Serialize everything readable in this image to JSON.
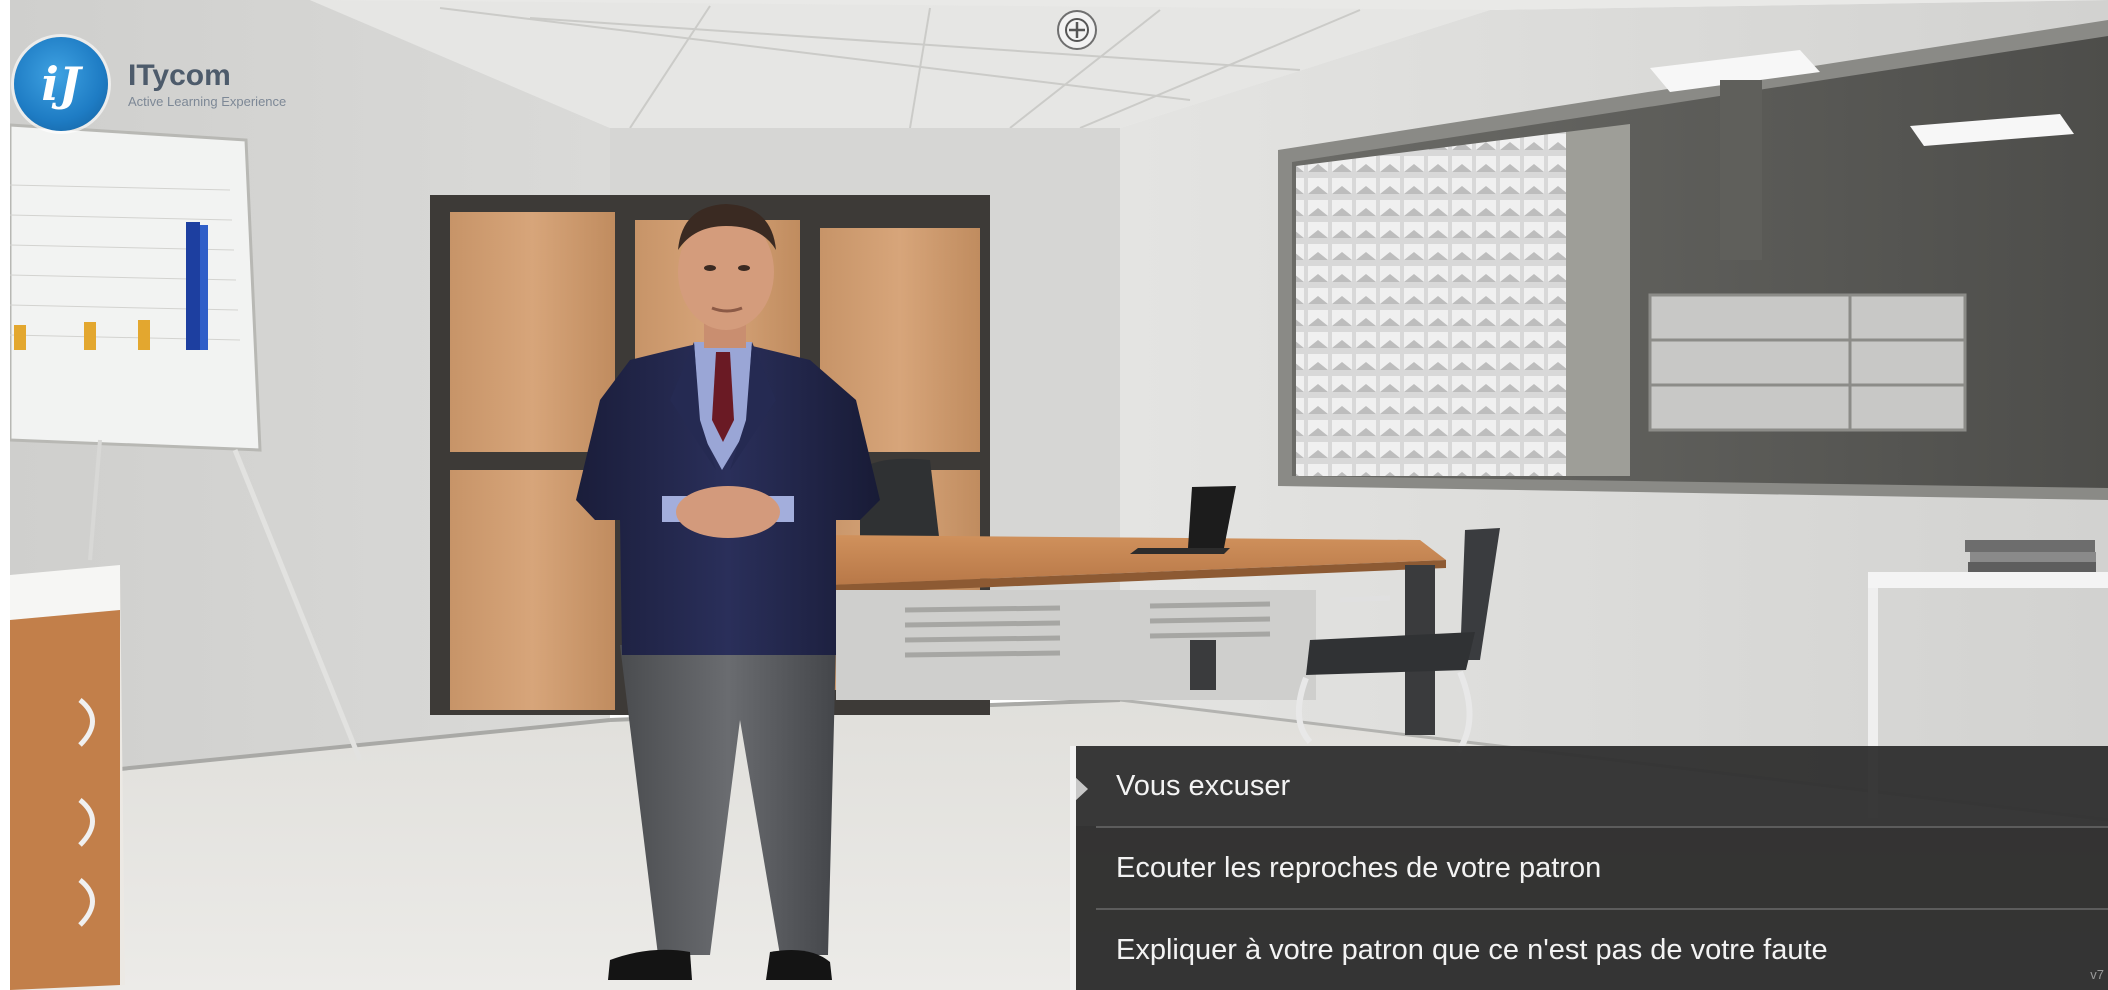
{
  "app": {
    "brand_name": "ITycom",
    "brand_tagline": "Active Learning Experience",
    "logo_glyph": "iJ",
    "version": "v7"
  },
  "scene": {
    "description_icons": [
      "expand-icon"
    ]
  },
  "dialogue": {
    "choices": [
      {
        "label": "Vous excuser",
        "selected": true
      },
      {
        "label": "Ecouter les reproches de votre patron",
        "selected": false
      },
      {
        "label": "Expliquer à votre patron que ce n'est pas de votre faute",
        "selected": false
      }
    ]
  },
  "colors": {
    "panel_bg": "#262626",
    "panel_text": "#f3f3f3",
    "logo_blue": "#1e7cc4",
    "desk_wood": "#c98a55",
    "suit_navy": "#1f2345"
  }
}
